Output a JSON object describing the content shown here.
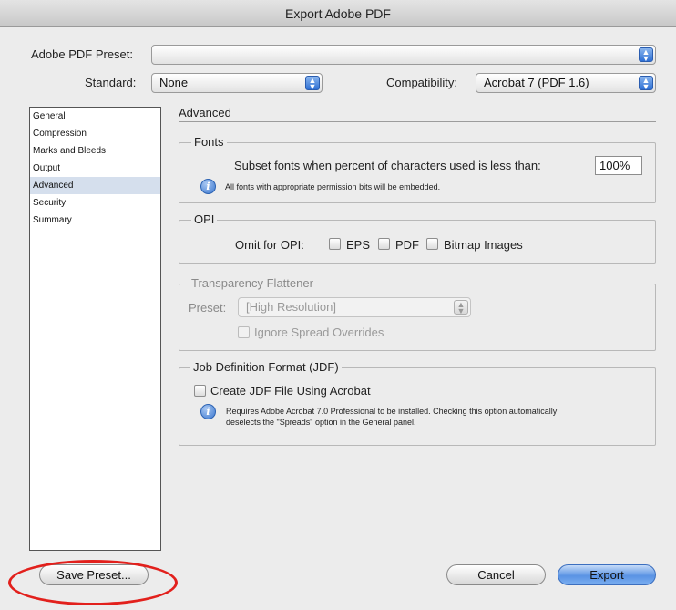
{
  "window": {
    "title": "Export Adobe PDF"
  },
  "preset": {
    "label": "Adobe PDF Preset:",
    "value": ""
  },
  "standard": {
    "label": "Standard:",
    "value": "None"
  },
  "compatibility": {
    "label": "Compatibility:",
    "value": "Acrobat 7 (PDF 1.6)"
  },
  "sidebar": {
    "items": [
      {
        "label": "General",
        "selected": false
      },
      {
        "label": "Compression",
        "selected": false
      },
      {
        "label": "Marks and Bleeds",
        "selected": false
      },
      {
        "label": "Output",
        "selected": false
      },
      {
        "label": "Advanced",
        "selected": true
      },
      {
        "label": "Security",
        "selected": false
      },
      {
        "label": "Summary",
        "selected": false
      }
    ]
  },
  "section": {
    "title": "Advanced"
  },
  "fonts": {
    "title": "Fonts",
    "subset_label": "Subset fonts when percent of characters used is less than:",
    "subset_value": "100%",
    "note": "All fonts with appropriate permission bits will be embedded."
  },
  "opi": {
    "title": "OPI",
    "omit_label": "Omit for OPI:",
    "eps_label": "EPS",
    "pdf_label": "PDF",
    "bitmap_label": "Bitmap Images"
  },
  "transparency": {
    "title": "Transparency Flattener",
    "preset_label": "Preset:",
    "preset_value": "[High Resolution]",
    "ignore_label": "Ignore Spread Overrides"
  },
  "jdf": {
    "title": "Job Definition Format (JDF)",
    "create_label": "Create JDF File Using Acrobat",
    "note_line1": "Requires Adobe Acrobat 7.0 Professional to be installed. Checking this option automatically",
    "note_line2": "deselects the \"Spreads\" option in the General panel."
  },
  "buttons": {
    "save_preset": "Save Preset...",
    "cancel": "Cancel",
    "export": "Export"
  },
  "colors": {
    "accent": "#3c78d0",
    "selection": "#d5dfed",
    "annotation": "#e2201c"
  }
}
